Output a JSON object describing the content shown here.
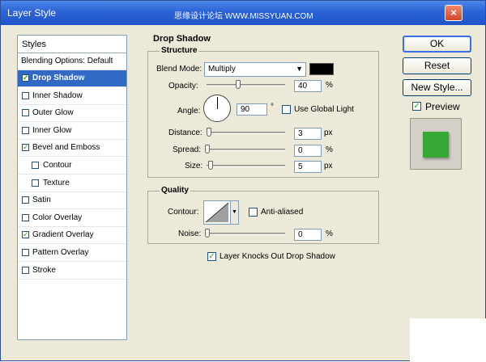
{
  "window": {
    "title": "Layer Style",
    "watermark": "思缘设计论坛 WWW.MISSYUAN.COM",
    "close": "×"
  },
  "styles_list": {
    "header": "Styles",
    "blending_options": "Blending Options: Default",
    "items": [
      {
        "label": "Drop Shadow",
        "checked": true,
        "selected": true,
        "indent": false
      },
      {
        "label": "Inner Shadow",
        "checked": false,
        "selected": false,
        "indent": false
      },
      {
        "label": "Outer Glow",
        "checked": false,
        "selected": false,
        "indent": false
      },
      {
        "label": "Inner Glow",
        "checked": false,
        "selected": false,
        "indent": false
      },
      {
        "label": "Bevel and Emboss",
        "checked": true,
        "selected": false,
        "indent": false
      },
      {
        "label": "Contour",
        "checked": false,
        "selected": false,
        "indent": true
      },
      {
        "label": "Texture",
        "checked": false,
        "selected": false,
        "indent": true
      },
      {
        "label": "Satin",
        "checked": false,
        "selected": false,
        "indent": false
      },
      {
        "label": "Color Overlay",
        "checked": false,
        "selected": false,
        "indent": false
      },
      {
        "label": "Gradient Overlay",
        "checked": true,
        "selected": false,
        "indent": false
      },
      {
        "label": "Pattern Overlay",
        "checked": false,
        "selected": false,
        "indent": false
      },
      {
        "label": "Stroke",
        "checked": false,
        "selected": false,
        "indent": false
      }
    ]
  },
  "drop_shadow": {
    "title": "Drop Shadow",
    "structure": {
      "title": "Structure",
      "blend_mode_label": "Blend Mode:",
      "blend_mode_value": "Multiply",
      "shadow_color": "#000000",
      "opacity_label": "Opacity:",
      "opacity_value": "40",
      "opacity_unit": "%",
      "opacity_fraction": 0.4,
      "angle_label": "Angle:",
      "angle_value": "90",
      "angle_unit": "°",
      "use_global_light_label": "Use Global Light",
      "use_global_light_checked": false,
      "distance_label": "Distance:",
      "distance_value": "3",
      "distance_unit": "px",
      "spread_label": "Spread:",
      "spread_value": "0",
      "spread_unit": "%",
      "size_label": "Size:",
      "size_value": "5",
      "size_unit": "px"
    },
    "quality": {
      "title": "Quality",
      "contour_label": "Contour:",
      "anti_aliased_label": "Anti-aliased",
      "anti_aliased_checked": false,
      "noise_label": "Noise:",
      "noise_value": "0",
      "noise_unit": "%"
    },
    "knockout_label": "Layer Knocks Out Drop Shadow",
    "knockout_checked": true
  },
  "buttons": {
    "ok": "OK",
    "reset": "Reset",
    "new_style": "New Style..."
  },
  "preview": {
    "label": "Preview",
    "checked": true,
    "swatch_color": "#35a835"
  },
  "colors": {
    "selection": "#316ac5",
    "dialog_bg": "#ece9d8",
    "title_bar": "#2b62d6"
  }
}
